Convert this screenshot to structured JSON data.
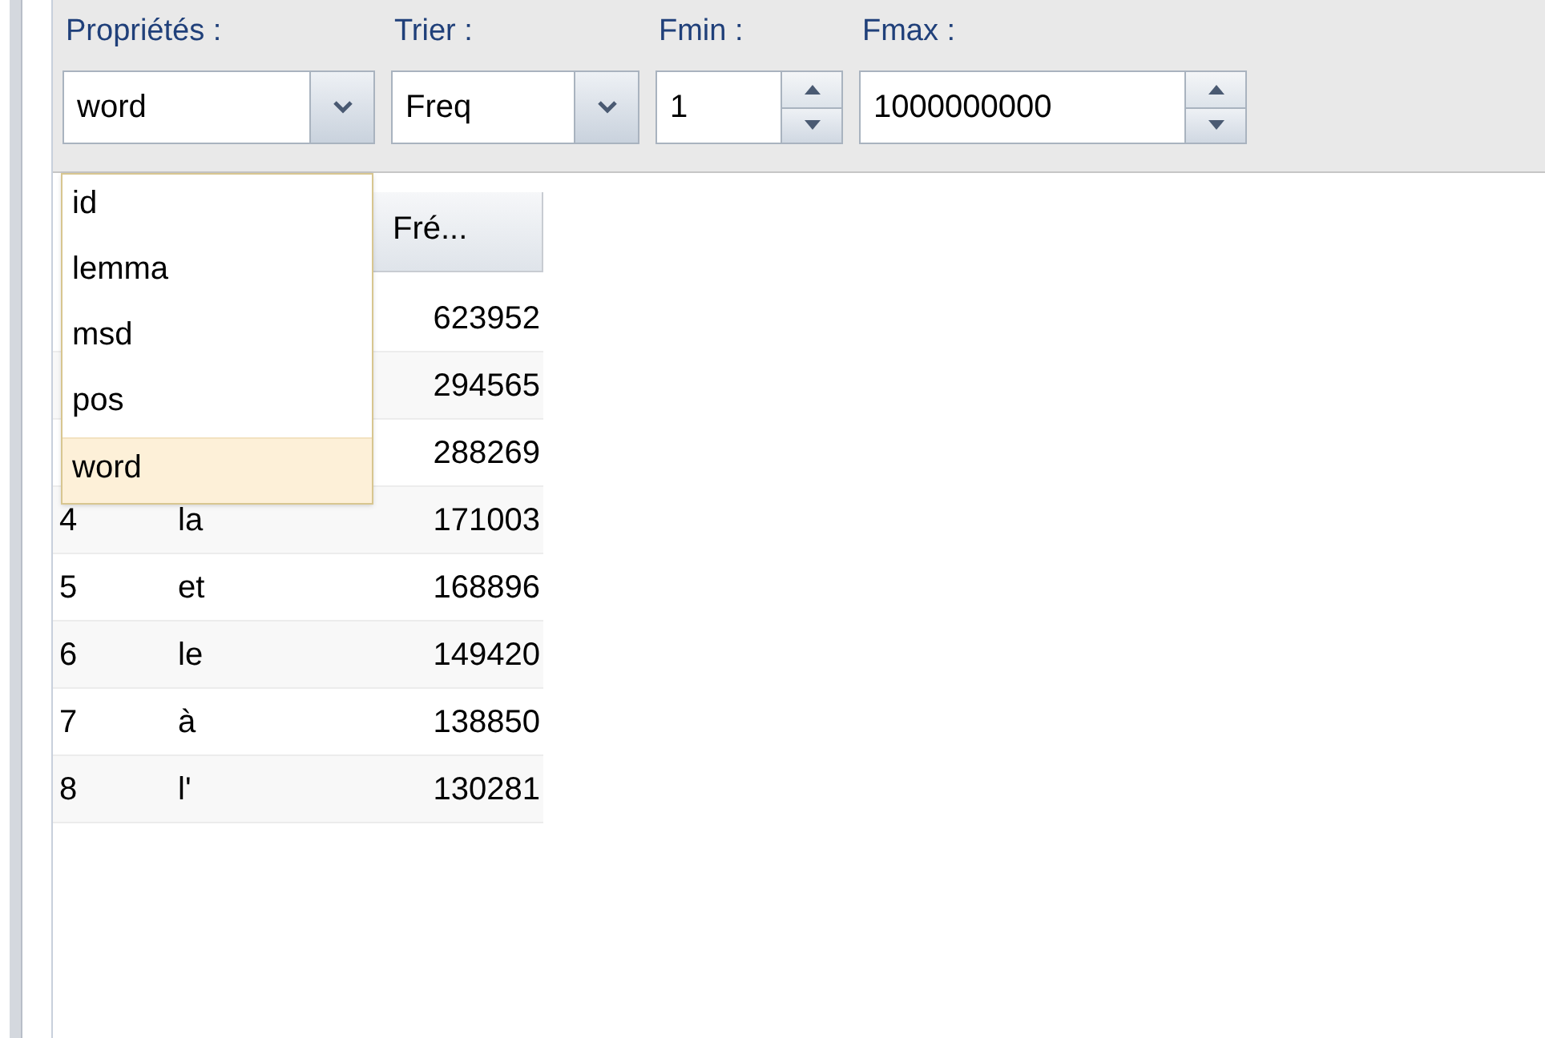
{
  "toolbar": {
    "fields": [
      {
        "kind": "combo",
        "label": "Propriétés :",
        "value": "word"
      },
      {
        "kind": "combo",
        "label": "Trier :",
        "value": "Freq"
      },
      {
        "kind": "spinner",
        "label": "Fmin :",
        "value": "1"
      },
      {
        "kind": "spinner",
        "label": "Fmax :",
        "value": "1000000000"
      }
    ]
  },
  "dropdown": {
    "items": [
      {
        "label": "id",
        "selected": false
      },
      {
        "label": "lemma",
        "selected": false
      },
      {
        "label": "msd",
        "selected": false
      },
      {
        "label": "pos",
        "selected": false
      },
      {
        "label": "word",
        "selected": true
      }
    ]
  },
  "table": {
    "columns": [
      {
        "label": "Fré..."
      }
    ],
    "rows": [
      {
        "cells": [
          "",
          "",
          "623952"
        ]
      },
      {
        "cells": [
          "",
          "",
          "294565"
        ]
      },
      {
        "cells": [
          "",
          "",
          "288269"
        ]
      },
      {
        "cells": [
          "4",
          "la",
          "171003"
        ]
      },
      {
        "cells": [
          "5",
          "et",
          "168896"
        ]
      },
      {
        "cells": [
          "6",
          "le",
          "149420"
        ]
      },
      {
        "cells": [
          "7",
          "à",
          "138850"
        ]
      },
      {
        "cells": [
          "8",
          "l'",
          "130281"
        ]
      }
    ]
  }
}
